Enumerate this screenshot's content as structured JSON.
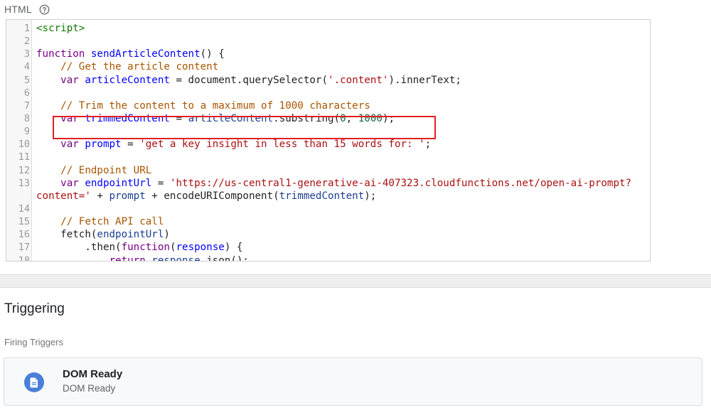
{
  "section_label": "HTML",
  "help_icon": "help-circle-icon",
  "code": {
    "lines": [
      {
        "n": "1",
        "parts": [
          {
            "t": "<script>",
            "c": "tag"
          }
        ]
      },
      {
        "n": "2",
        "parts": []
      },
      {
        "n": "3",
        "parts": [
          {
            "t": "function",
            "c": "kw"
          },
          {
            "t": " ",
            "c": ""
          },
          {
            "t": "sendArticleContent",
            "c": "fn"
          },
          {
            "t": "() {",
            "c": ""
          }
        ]
      },
      {
        "n": "4",
        "parts": [
          {
            "t": "    ",
            "c": ""
          },
          {
            "t": "// Get the article content",
            "c": "cm"
          }
        ]
      },
      {
        "n": "5",
        "parts": [
          {
            "t": "    ",
            "c": ""
          },
          {
            "t": "var",
            "c": "kw"
          },
          {
            "t": " ",
            "c": ""
          },
          {
            "t": "articleContent",
            "c": "fn"
          },
          {
            "t": " = document.querySelector(",
            "c": ""
          },
          {
            "t": "'.content'",
            "c": "str"
          },
          {
            "t": ").innerText;",
            "c": ""
          }
        ]
      },
      {
        "n": "6",
        "parts": []
      },
      {
        "n": "7",
        "parts": [
          {
            "t": "    ",
            "c": ""
          },
          {
            "t": "// Trim the content to a maximum of 1000 characters",
            "c": "cm"
          }
        ]
      },
      {
        "n": "8",
        "parts": [
          {
            "t": "    ",
            "c": ""
          },
          {
            "t": "var",
            "c": "kw"
          },
          {
            "t": " ",
            "c": ""
          },
          {
            "t": "trimmedContent",
            "c": "fn"
          },
          {
            "t": " = ",
            "c": ""
          },
          {
            "t": "articleContent",
            "c": "var"
          },
          {
            "t": ".substring(",
            "c": ""
          },
          {
            "t": "0",
            "c": "num"
          },
          {
            "t": ", ",
            "c": ""
          },
          {
            "t": "1000",
            "c": "num"
          },
          {
            "t": ");",
            "c": ""
          }
        ]
      },
      {
        "n": "9",
        "parts": []
      },
      {
        "n": "10",
        "parts": [
          {
            "t": "    ",
            "c": ""
          },
          {
            "t": "var",
            "c": "kw"
          },
          {
            "t": " ",
            "c": ""
          },
          {
            "t": "prompt",
            "c": "fn"
          },
          {
            "t": " = ",
            "c": ""
          },
          {
            "t": "'get a key insight in less than 15 words for: '",
            "c": "str"
          },
          {
            "t": ";",
            "c": ""
          }
        ]
      },
      {
        "n": "11",
        "parts": []
      },
      {
        "n": "12",
        "parts": [
          {
            "t": "    ",
            "c": ""
          },
          {
            "t": "// Endpoint URL",
            "c": "cm"
          }
        ]
      },
      {
        "n": "13",
        "parts": [
          {
            "t": "    ",
            "c": ""
          },
          {
            "t": "var",
            "c": "kw"
          },
          {
            "t": " ",
            "c": ""
          },
          {
            "t": "endpointUrl",
            "c": "fn"
          },
          {
            "t": " = ",
            "c": ""
          },
          {
            "t": "'https://us-central1-generative-ai-407323.cloudfunctions.net/open-ai-prompt?",
            "c": "str"
          }
        ]
      },
      {
        "n": "",
        "parts": [
          {
            "t": "content='",
            "c": "str"
          },
          {
            "t": " + ",
            "c": ""
          },
          {
            "t": "prompt",
            "c": "var"
          },
          {
            "t": " + encodeURIComponent(",
            "c": ""
          },
          {
            "t": "trimmedContent",
            "c": "var"
          },
          {
            "t": ");",
            "c": ""
          }
        ]
      },
      {
        "n": "14",
        "parts": []
      },
      {
        "n": "15",
        "parts": [
          {
            "t": "    ",
            "c": ""
          },
          {
            "t": "// Fetch API call",
            "c": "cm"
          }
        ]
      },
      {
        "n": "16",
        "parts": [
          {
            "t": "    fetch(",
            "c": ""
          },
          {
            "t": "endpointUrl",
            "c": "var"
          },
          {
            "t": ")",
            "c": ""
          }
        ]
      },
      {
        "n": "17",
        "parts": [
          {
            "t": "        .then(",
            "c": ""
          },
          {
            "t": "function",
            "c": "kw"
          },
          {
            "t": "(",
            "c": ""
          },
          {
            "t": "response",
            "c": "fn"
          },
          {
            "t": ") {",
            "c": ""
          }
        ]
      },
      {
        "n": "18",
        "parts": [
          {
            "t": "            ",
            "c": ""
          },
          {
            "t": "return",
            "c": "kw"
          },
          {
            "t": " ",
            "c": ""
          },
          {
            "t": "response",
            "c": "var"
          },
          {
            "t": ".json();",
            "c": ""
          }
        ]
      }
    ]
  },
  "triggering": {
    "title": "Triggering",
    "firing_label": "Firing Triggers",
    "trigger": {
      "name": "DOM Ready",
      "type": "DOM Ready",
      "icon": "document-icon",
      "icon_color": "#4a7fd9"
    }
  },
  "colors": {
    "highlight": "#e02020",
    "keyword": "#770088",
    "string": "#aa1111",
    "comment": "#aa5500",
    "number": "#116644"
  }
}
